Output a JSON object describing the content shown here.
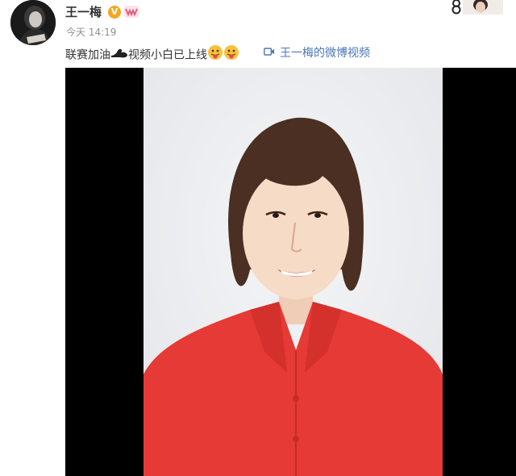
{
  "post": {
    "username": "王一梅",
    "verified_badge": "V",
    "member_icon": "weibo-member-icon",
    "timestamp": "今天 14:19",
    "text_part1": "联赛加油",
    "text_part2": "视频小白已上线",
    "emojis": [
      "flexed-biceps-icon",
      "tongue-face-icon",
      "tongue-face-icon"
    ],
    "video_link_label": "王一梅的微博视频"
  },
  "media": {
    "description_icon": "portrait-photo"
  },
  "colors": {
    "link": "#4a76b8",
    "badge": "#f5a623",
    "text": "#333333",
    "meta": "#8f8f8f",
    "shirt": "#e53a35"
  }
}
